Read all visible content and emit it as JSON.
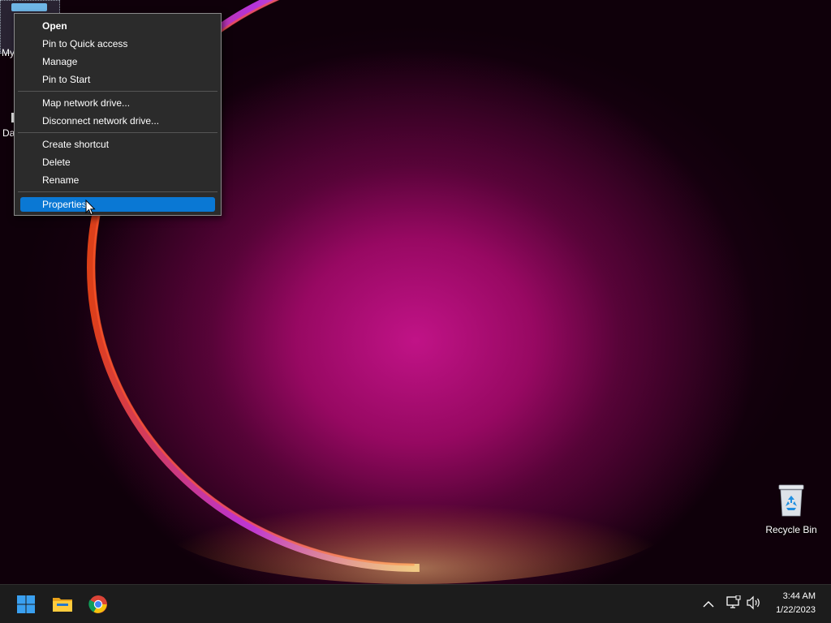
{
  "desktop": {
    "icons": {
      "my_pc_label": "My",
      "data_label": "Da",
      "recycle_bin_label": "Recycle Bin"
    }
  },
  "context_menu": {
    "items": [
      {
        "label": "Open",
        "bold": true
      },
      {
        "label": "Pin to Quick access"
      },
      {
        "label": "Manage"
      },
      {
        "label": "Pin to Start"
      },
      {
        "label": "Map network drive..."
      },
      {
        "label": "Disconnect network drive..."
      },
      {
        "label": "Create shortcut"
      },
      {
        "label": "Delete"
      },
      {
        "label": "Rename"
      },
      {
        "label": "Properties",
        "highlighted": true
      }
    ],
    "highlight_color": "#0a78d4"
  },
  "taskbar": {
    "pinned": [
      {
        "icon": "windows-start-icon"
      },
      {
        "icon": "file-explorer-icon"
      },
      {
        "icon": "chrome-icon"
      }
    ],
    "tray": {
      "icons": [
        "chevron-up-icon",
        "network-icon",
        "volume-icon"
      ],
      "time": "3:44 AM",
      "date": "1/22/2023"
    }
  }
}
